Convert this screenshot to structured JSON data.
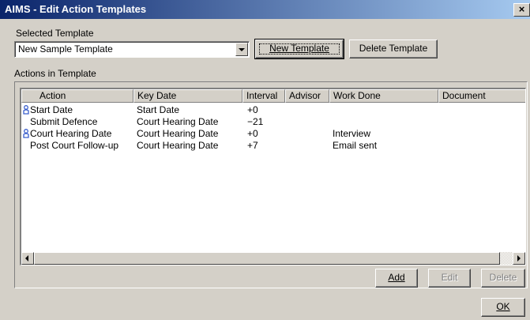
{
  "window": {
    "title": "AIMS - Edit Action Templates",
    "close_glyph": "×"
  },
  "selected_template": {
    "label": "Selected Template",
    "value": "New Sample Template"
  },
  "buttons": {
    "new_template": "New Template",
    "delete_template": "Delete Template",
    "add": "Add",
    "edit": "Edit",
    "delete": "Delete",
    "ok": "OK"
  },
  "actions": {
    "label": "Actions in Template",
    "columns": [
      "Action",
      "Key Date",
      "Interval",
      "Advisor",
      "Work Done",
      "Document"
    ],
    "rows": [
      {
        "icon": "person-icon",
        "action": "Start Date",
        "key_date": "Start Date",
        "interval": "+0",
        "advisor": "",
        "work_done": "",
        "document": ""
      },
      {
        "icon": "",
        "action": "Submit Defence",
        "key_date": "Court Hearing Date",
        "interval": "−21",
        "advisor": "",
        "work_done": "",
        "document": ""
      },
      {
        "icon": "person-icon",
        "action": "Court Hearing Date",
        "key_date": "Court Hearing Date",
        "interval": "+0",
        "advisor": "",
        "work_done": "Interview",
        "document": ""
      },
      {
        "icon": "",
        "action": "Post Court Follow-up",
        "key_date": "Court Hearing Date",
        "interval": "+7",
        "advisor": "",
        "work_done": "Email sent",
        "document": ""
      }
    ]
  },
  "colors": {
    "title_bar_start": "#0a246a",
    "title_bar_end": "#a6caf0",
    "dialog_face": "#d4d0c8",
    "person_icon": "#3a5fcd"
  }
}
